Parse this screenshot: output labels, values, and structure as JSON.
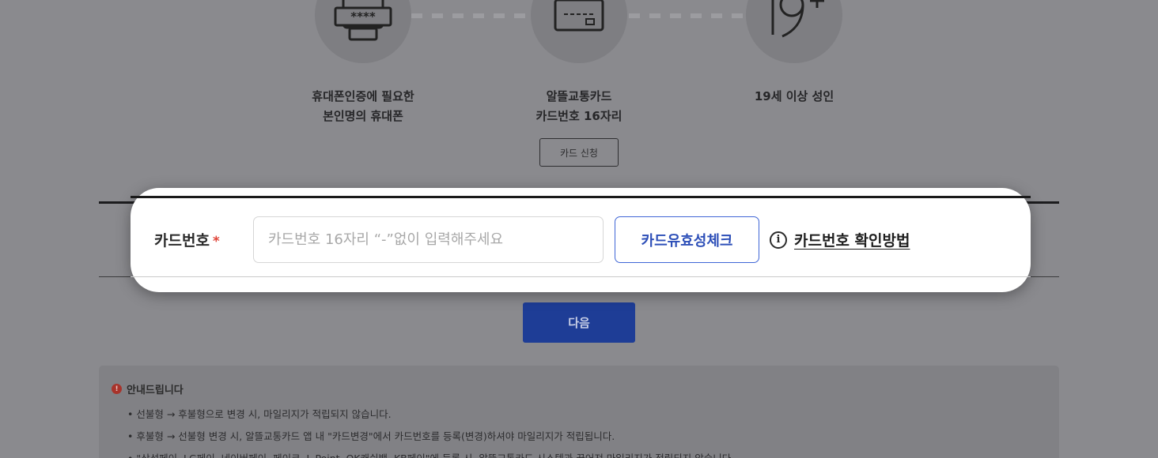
{
  "requirements": [
    {
      "icon": "phone-password-icon",
      "text_line1": "휴대폰인증에 필요한",
      "text_line2": "본인명의 휴대폰",
      "icon_label": "****"
    },
    {
      "icon": "card-icon",
      "text_line1": "알뜰교통카드",
      "text_line2": "카드번호 16자리"
    },
    {
      "icon": "age-19-plus-icon",
      "text_line1": "19세 이상 성인",
      "text_line2": ""
    }
  ],
  "card_apply_label": "카드 신청",
  "form": {
    "label": "카드번호",
    "required_mark": "*",
    "placeholder": "카드번호 16자리 “-”없이 입력해주세요",
    "value": "",
    "validity_button": "카드유효성체크",
    "howto_link": "카드번호 확인방법",
    "info_glyph": "i"
  },
  "next_button": "다음",
  "notice": {
    "title": "안내드립니다",
    "glyph": "!",
    "items": [
      "선불형 → 후불형으로 변경 시, 마일리지가 적립되지 않습니다.",
      "후불형 → 선불형 변경 시, 알뜰교통카드 앱 내 \"카드변경\"에서 카드번호를 등록(변경)하셔야 마일리지가 적립됩니다.",
      "\"삼성페이, LG페이, 네이버페이, 페이코, L.Point, OK캐쉬백, KB페이\"에 등록 시, 알뜰교통카드 시스템과 끊어져 마일리지가 적립되지 않습니다."
    ]
  },
  "colors": {
    "overlay": "#8a8a8e",
    "accent": "#3f66d6",
    "primary_button": "#1e3d96",
    "required": "#e0463a"
  }
}
